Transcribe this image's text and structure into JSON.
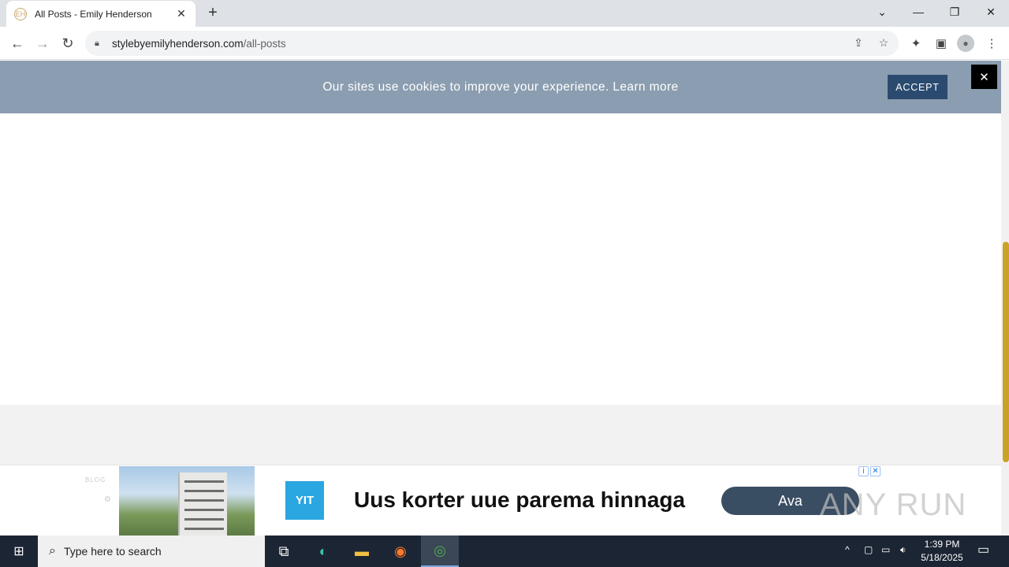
{
  "browser": {
    "tab_title": "All Posts - Emily Henderson",
    "url_host": "stylebyemilyhenderson.com",
    "url_path": "/all-posts"
  },
  "cookie_banner": {
    "message": "Our sites use cookies to improve your experience. Learn more",
    "accept_label": "ACCEPT",
    "close_label": "✕"
  },
  "ad": {
    "ghost_label": "BLOG",
    "logo_text": "YIT",
    "headline": "Uus korter uue parema hinnaga",
    "cta_label": "Ava",
    "watermark": "ANY RUN"
  },
  "taskbar": {
    "search_placeholder": "Type here to search",
    "time": "1:39 PM",
    "date": "5/18/2025"
  },
  "colors": {
    "cookie_bg": "#8b9db0",
    "accept_bg": "#2b4a6f",
    "scroll_thumb": "#c9a227",
    "ad_logo": "#2aa6e0",
    "ad_cta": "#3a4e63"
  },
  "icons": [
    "favicon-icon",
    "close-tab-icon",
    "new-tab-icon",
    "dropdown-icon",
    "minimize-icon",
    "restore-icon",
    "close-window-icon",
    "back-icon",
    "forward-icon",
    "reload-icon",
    "lock-icon",
    "share-icon",
    "star-icon",
    "extensions-icon",
    "sidepanel-icon",
    "profile-icon",
    "menu-icon",
    "windows-icon",
    "search-icon",
    "taskview-icon",
    "edge-icon",
    "folder-icon",
    "firefox-icon",
    "chrome-icon"
  ]
}
